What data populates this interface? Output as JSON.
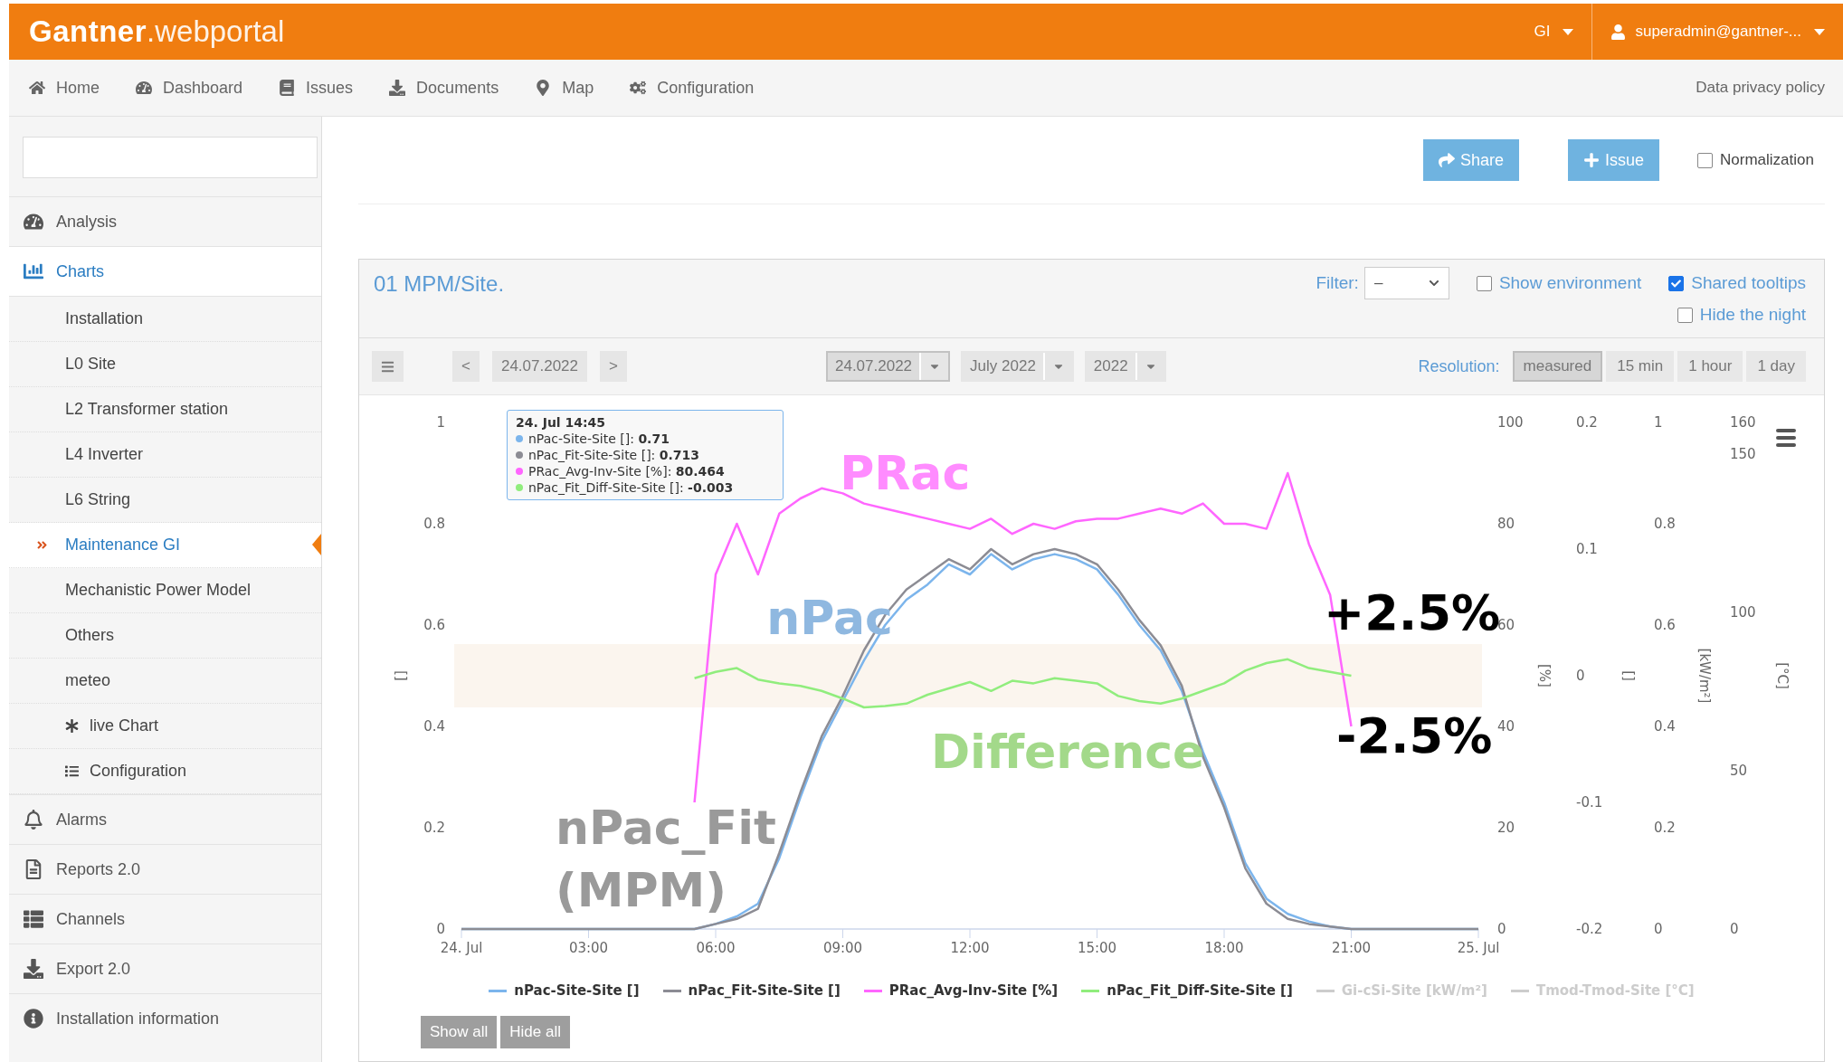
{
  "header": {
    "logo_brand": "Gantner",
    "logo_product": ".webportal",
    "region": "GI",
    "user": "superadmin@gantner-..."
  },
  "nav": {
    "items": [
      "Home",
      "Dashboard",
      "Issues",
      "Documents",
      "Map",
      "Configuration"
    ],
    "privacy_link": "Data privacy policy"
  },
  "sidebar": {
    "items": [
      {
        "label": "Analysis",
        "selected": false
      },
      {
        "label": "Charts",
        "selected": true,
        "children": [
          {
            "label": "Installation",
            "selected": false
          },
          {
            "label": "L0 Site",
            "selected": false
          },
          {
            "label": "L2 Transformer station",
            "selected": false
          },
          {
            "label": "L4 Inverter",
            "selected": false
          },
          {
            "label": "L6 String",
            "selected": false
          },
          {
            "label": "Maintenance GI",
            "selected": true
          },
          {
            "label": "Mechanistic Power Model",
            "selected": false
          },
          {
            "label": "Others",
            "selected": false
          },
          {
            "label": "meteo",
            "selected": false
          },
          {
            "label": "live Chart",
            "selected": false
          },
          {
            "label": "Configuration",
            "selected": false
          }
        ]
      },
      {
        "label": "Alarms",
        "selected": false
      },
      {
        "label": "Reports 2.0",
        "selected": false
      },
      {
        "label": "Channels",
        "selected": false
      },
      {
        "label": "Export 2.0",
        "selected": false
      },
      {
        "label": "Installation information",
        "selected": false
      }
    ]
  },
  "toolbar": {
    "buttons": [
      "Share",
      "Issue"
    ],
    "normalization": {
      "label": "Normalization",
      "checked": false
    }
  },
  "panel": {
    "title": "01 MPM/Site.",
    "filter": {
      "label": "Filter:",
      "value": "–"
    },
    "options": [
      {
        "label": "Show environment",
        "checked": false
      },
      {
        "label": "Shared tooltips",
        "checked": true
      },
      {
        "label": "Hide the night",
        "checked": false
      }
    ],
    "date_nav": {
      "prev": "<",
      "date": "24.07.2022",
      "next": ">"
    },
    "pickers": [
      {
        "label": "24.07.2022",
        "selected": true
      },
      {
        "label": "July 2022",
        "selected": false
      },
      {
        "label": "2022",
        "selected": false
      }
    ],
    "resolution": {
      "label": "Resolution:",
      "options": [
        {
          "label": "measured",
          "selected": true
        },
        {
          "label": "15 min",
          "selected": false
        },
        {
          "label": "1 hour",
          "selected": false
        },
        {
          "label": "1 day",
          "selected": false
        }
      ]
    },
    "chart": {
      "chart_data": {
        "type": "line",
        "ylabel": "[]",
        "x": [
          0,
          0.5,
          1,
          1.5,
          2,
          2.5,
          3,
          3.5,
          4,
          4.5,
          5,
          5.5,
          6,
          6.5,
          7,
          7.5,
          8,
          8.5,
          9,
          9.5,
          10,
          10.5,
          11,
          11.5,
          12,
          12.5,
          13,
          13.5,
          14,
          14.5,
          15,
          15.5,
          16,
          16.5,
          17,
          17.5,
          18,
          18.5,
          19,
          19.5,
          20,
          20.5,
          21,
          21.5,
          22,
          22.5,
          23,
          23.5,
          24
        ],
        "xlim": [
          0,
          24
        ],
        "ylim": [
          0,
          1
        ],
        "xticks": [
          {
            "value": 0,
            "label": "24. Jul"
          },
          {
            "value": 3,
            "label": "03:00"
          },
          {
            "value": 6,
            "label": "06:00"
          },
          {
            "value": 9,
            "label": "09:00"
          },
          {
            "value": 12,
            "label": "12:00"
          },
          {
            "value": 15,
            "label": "15:00"
          },
          {
            "value": 18,
            "label": "18:00"
          },
          {
            "value": 21,
            "label": "21:00"
          },
          {
            "value": 24,
            "label": "25. Jul"
          }
        ],
        "yticks": [
          0,
          0.2,
          0.4,
          0.6,
          0.8,
          1
        ],
        "y2label": "[%]",
        "y2lim": [
          0,
          100
        ],
        "y2ticks": [
          0,
          20,
          40,
          60,
          80,
          100
        ],
        "y3label": "[]",
        "y3lim": [
          -0.2,
          0.2
        ],
        "y3ticks": [
          -0.2,
          -0.1,
          0,
          0.1,
          0.2
        ],
        "bands": [
          {
            "axis": "y3",
            "from": -0.025,
            "to": 0.025
          }
        ],
        "series": [
          {
            "name": "nPac-Site-Site []",
            "color": "#7cb5ec",
            "values": [
              0,
              0,
              0,
              0,
              0,
              0,
              0,
              0,
              0,
              0,
              0,
              0,
              0.01,
              0.025,
              0.05,
              0.14,
              0.26,
              0.37,
              0.45,
              0.53,
              0.6,
              0.65,
              0.68,
              0.72,
              0.7,
              0.74,
              0.71,
              0.73,
              0.74,
              0.73,
              0.71,
              0.66,
              0.6,
              0.55,
              0.47,
              0.35,
              0.25,
              0.13,
              0.06,
              0.03,
              0.015,
              0.005,
              0,
              0,
              0,
              0,
              0,
              0,
              0
            ]
          },
          {
            "name": "nPac_Fit-Site-Site []",
            "color": "#8c8c94",
            "values": [
              0,
              0,
              0,
              0,
              0,
              0,
              0,
              0,
              0,
              0,
              0,
              0,
              0.01,
              0.02,
              0.04,
              0.15,
              0.27,
              0.38,
              0.46,
              0.55,
              0.62,
              0.67,
              0.7,
              0.73,
              0.71,
              0.75,
              0.72,
              0.74,
              0.75,
              0.74,
              0.72,
              0.67,
              0.61,
              0.56,
              0.48,
              0.34,
              0.24,
              0.12,
              0.05,
              0.02,
              0.01,
              0.005,
              0,
              0,
              0,
              0,
              0,
              0,
              0
            ]
          },
          {
            "name": "PRac_Avg-Inv-Site [%]",
            "color": "#ff66ff",
            "axis": "y2",
            "values": [
              null,
              null,
              null,
              null,
              null,
              null,
              null,
              null,
              null,
              null,
              null,
              25,
              70,
              80,
              70,
              82,
              85,
              87,
              86,
              84,
              83,
              82,
              81,
              80,
              79,
              81,
              78,
              80,
              79,
              80.5,
              81,
              81,
              82,
              83,
              82,
              84,
              80,
              80,
              79,
              90,
              76,
              66,
              40,
              null,
              null,
              null,
              null,
              null,
              null
            ]
          },
          {
            "name": "nPac_Fit_Diff-Site-Site []",
            "color": "#90ed7d",
            "axis": "y3",
            "values": [
              null,
              null,
              null,
              null,
              null,
              null,
              null,
              null,
              null,
              null,
              null,
              -0.002,
              0.003,
              0.006,
              -0.003,
              -0.006,
              -0.008,
              -0.012,
              -0.018,
              -0.025,
              -0.024,
              -0.022,
              -0.015,
              -0.01,
              -0.005,
              -0.012,
              -0.004,
              -0.006,
              -0.002,
              -0.004,
              -0.006,
              -0.016,
              -0.02,
              -0.022,
              -0.018,
              -0.012,
              -0.006,
              0.004,
              0.01,
              0.013,
              0.006,
              0.003,
              0,
              null,
              null,
              null,
              null,
              null,
              null
            ]
          }
        ],
        "annotations": [
          "PRac",
          "nPac",
          "Difference",
          "nPac_Fit",
          "(MPM)",
          "+2.5%",
          "-2.5%"
        ]
      },
      "extra_axes": [
        {
          "label": "[kW/m²]",
          "ticks": [
            "1",
            "0.8",
            "0.6",
            "0.4",
            "0.2",
            "0"
          ]
        },
        {
          "label": "[°C]",
          "ticks": [
            "160",
            "150",
            "100",
            "50",
            "0"
          ]
        }
      ],
      "tooltip": {
        "title": "24. Jul 14:45",
        "rows": [
          {
            "text": "nPac-Site-Site []: **0.71**",
            "color": "#7cb5ec"
          },
          {
            "text": "nPac_Fit-Site-Site []: **0.713**",
            "color": "#8c8c94"
          },
          {
            "text": "PRac_Avg-Inv-Site [%]: **80.464**",
            "color": "#ff66ff"
          },
          {
            "text": "nPac_Fit_Diff-Site-Site []: **-0.003**",
            "color": "#90ed7d"
          }
        ]
      },
      "legend": [
        {
          "visible": true
        },
        {
          "visible": true
        },
        {
          "visible": true
        },
        {
          "visible": true
        },
        {
          "label": "Gi-cSi-Site [kW/m²]",
          "visible": false
        },
        {
          "label": "Tmod-Tmod-Site [°C]",
          "visible": false
        }
      ],
      "buttons": [
        "Show all",
        "Hide all"
      ]
    }
  }
}
